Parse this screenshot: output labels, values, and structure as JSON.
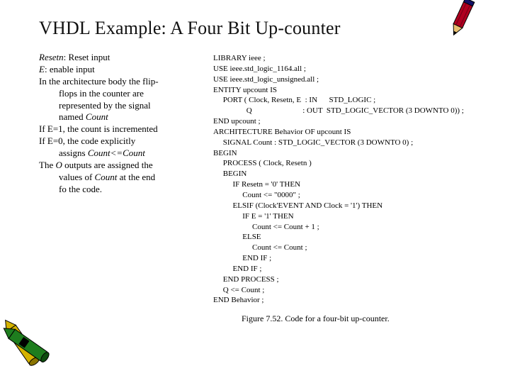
{
  "title": "VHDL Example: A Four Bit Up-counter",
  "left": {
    "l1a": "Resetn",
    "l1b": ": Reset input",
    "l2a": "E",
    "l2b": ": enable input",
    "l3": "In the architecture body the flip-",
    "l3i1": "flops in the counter are",
    "l3i2": "represented by the signal",
    "l3i3": "named ",
    "l3i3b": "Count",
    "l4": "If E=1, the count is incremented",
    "l5": "If E=0, the code explicitly",
    "l5i1": "assigns ",
    "l5i1b": "Count<=Count",
    "l6": "The ",
    "l6b": "O",
    "l6c": " outputs are assigned the",
    "l6i1": "values of ",
    "l6i1b": "Count",
    "l6i1c": " at the end",
    "l6i2": "fo the code."
  },
  "code": {
    "c1": "LIBRARY ieee ;",
    "c2": "USE ieee.std_logic_1164.all ;",
    "c3": "USE ieee.std_logic_unsigned.all ;",
    "c4": "",
    "c5": "ENTITY upcount IS",
    "c6": "     PORT ( Clock, Resetn, E  : IN      STD_LOGIC ;",
    "c7": "                 Q                          : OUT  STD_LOGIC_VECTOR (3 DOWNTO 0)) ;",
    "c8": "END upcount ;",
    "c9": "",
    "c10": "ARCHITECTURE Behavior OF upcount IS",
    "c11": "     SIGNAL Count : STD_LOGIC_VECTOR (3 DOWNTO 0) ;",
    "c12": "BEGIN",
    "c13": "     PROCESS ( Clock, Resetn )",
    "c14": "     BEGIN",
    "c15": "          IF Resetn = '0' THEN",
    "c16": "               Count <= \"0000\" ;",
    "c17": "          ELSIF (Clock'EVENT AND Clock = '1') THEN",
    "c18": "               IF E = '1' THEN",
    "c19": "                    Count <= Count + 1 ;",
    "c20": "               ELSE",
    "c21": "                    Count <= Count ;",
    "c22": "               END IF ;",
    "c23": "          END IF ;",
    "c24": "     END PROCESS ;",
    "c25": "     Q <= Count ;",
    "c26": "END Behavior ;"
  },
  "figcaption": "Figure 7.52.   Code for a four-bit up-counter."
}
